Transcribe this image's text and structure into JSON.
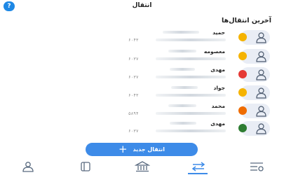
{
  "header": {
    "title": "انتقال",
    "help_label": "?"
  },
  "section_title": "آخرین انتقال‌ها",
  "transfers": [
    {
      "name": "حمید",
      "suffix": "۶۰۴۳",
      "bank": "yellow-bank-logo",
      "bank_color": "#f5b301"
    },
    {
      "name": "معصومه",
      "suffix": "۶۰۳۷",
      "bank": "yellow-bank-logo",
      "bank_color": "#f5b301"
    },
    {
      "name": "مهدی",
      "suffix": "۶۰۳۷",
      "bank": "red-bank-logo",
      "bank_color": "#e53935"
    },
    {
      "name": "جواد",
      "suffix": "۶۰۴۳",
      "bank": "yellow-bank-logo",
      "bank_color": "#f5b301"
    },
    {
      "name": "محمد",
      "suffix": "۵۸۹۴",
      "bank": "orange-bank-logo",
      "bank_color": "#ef6c00"
    },
    {
      "name": "مهدی",
      "suffix": "۶۰۳۷",
      "bank": "green-bank-logo",
      "bank_color": "#2e7d32"
    }
  ],
  "new_transfer_label": "انتقال جدید",
  "bottom_nav": {
    "items": [
      "profile-icon",
      "cards-icon",
      "bank-icon",
      "transfer-icon",
      "services-icon"
    ],
    "active": "transfer-icon"
  },
  "colors": {
    "accent": "#3d8be8",
    "avatar_bg": "#e9edf5"
  }
}
